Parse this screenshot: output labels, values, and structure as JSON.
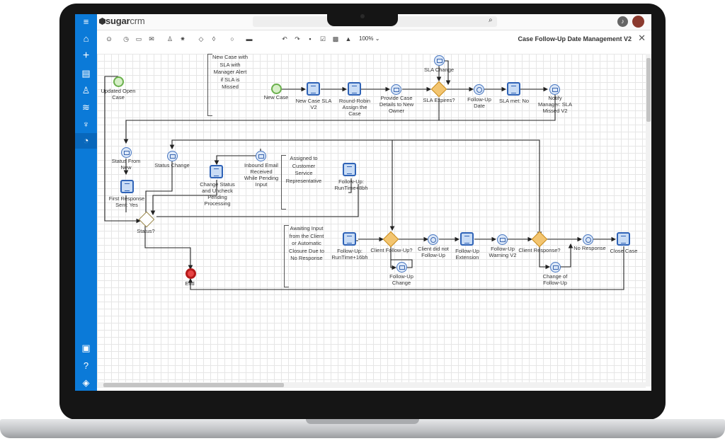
{
  "app": {
    "brand_bold": "sugar",
    "brand_light": "crm"
  },
  "diagram_title": "Case Follow-Up Date Management V2",
  "zoom": "100%",
  "colors": {
    "sidebar": "#0b7ad8",
    "task_border": "#2f63b7",
    "gateway": "#f3c570",
    "start": "#6ab04c",
    "end": "#b51a1a"
  },
  "sidebar": {
    "top_icons": [
      "menu-icon",
      "home-icon",
      "plus-icon",
      "document-icon",
      "user-icon",
      "filter-icon",
      "trophy-icon",
      "process-icon"
    ],
    "bottom_icons": [
      "report-icon",
      "help-icon",
      "layers-icon"
    ]
  },
  "toolbar_icons": [
    "undo-icon",
    "redo-icon",
    "save-icon",
    "validate-icon",
    "image-icon",
    "warning-icon"
  ],
  "labels": {
    "updated_open_case": "Updated Open\nCase",
    "new_case": "New Case",
    "new_case_sla": "New Case SLA\nV2",
    "round_robin": "Round-Robin\nAssign the\nCase",
    "provide_case": "Provide Case\nDetails to New\nOwner",
    "sla_expires": "SLA Expires?",
    "sla_change": "SLA Change",
    "follow_up_date": "Follow-Up\nDate",
    "sla_met": "SLA met: No",
    "notify_manager": "Notify\nManager: SLA\nMissed V2",
    "status_from_new": "Status From\nNew",
    "status_change": "Status Change",
    "change_status": "Change Status\nand Uncheck\nPending\nProcessing",
    "inbound_email": "Inbound Email\nReceived\nWhile Pending\nInput",
    "first_response": "First Response\nSent: Yes",
    "status_gw": "Status?",
    "end": "End",
    "runtime_8": "Follow-Up:\nRunTime+8bh",
    "runtime_16": "Follow-Up:\nRunTime+16bh",
    "client_follow_up": "Client Follow-Up?",
    "client_did_not": "Client did not\nFollow-Up",
    "follow_up_ext": "Follow-Up\nExtension",
    "follow_up_warning": "Follow-Up\nWarning V2",
    "client_response": "Client Response?",
    "no_response": "No Response",
    "close_case": "Close Case",
    "follow_up_change": "Follow-Up\nChange",
    "change_of_follow_up": "Change of\nFollow-Up"
  },
  "notes": {
    "new_case_note": "New Case with\nSLA with\nManager Alert\nif SLA is\nMissed",
    "assigned_note": "Assigned to\nCustomer\nService\nRepresentative",
    "awaiting_note": "Awaiting Input\nfrom the Client\nor Automatic\nClosure Due to\nNo Response"
  }
}
